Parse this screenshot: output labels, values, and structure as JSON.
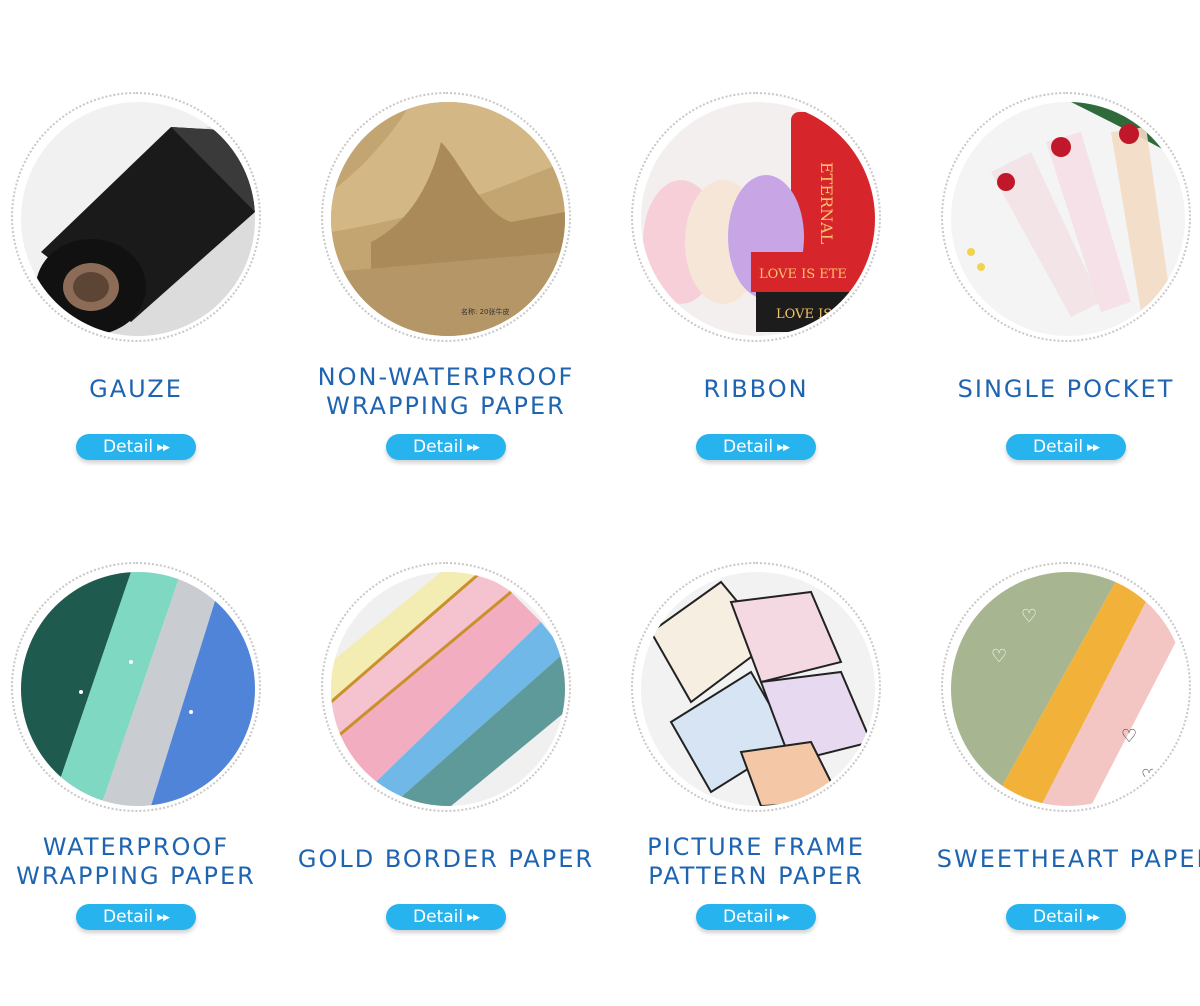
{
  "products": [
    {
      "title": "GAUZE",
      "button": "Detail",
      "image": "black-gauze-roll"
    },
    {
      "title": "NON-WATERPROOF WRAPPING PAPER",
      "button": "Detail",
      "image": "kraft-paper-sheets",
      "label": "名称: 20张牛皮"
    },
    {
      "title": "RIBBON",
      "button": "Detail",
      "image": "ribbon-rolls",
      "ribbon_text": [
        "LOVE IS ETE",
        "LOVE IS",
        "ETERNAL"
      ]
    },
    {
      "title": "SINGLE POCKET",
      "button": "Detail",
      "image": "rose-single-pocket"
    },
    {
      "title": "WATERPROOF WRAPPING PAPER",
      "button": "Detail",
      "image": "waterproof-paper-rolls"
    },
    {
      "title": "GOLD BORDER PAPER",
      "button": "Detail",
      "image": "gold-border-paper-rolls"
    },
    {
      "title": "PICTURE FRAME PATTERN PAPER",
      "button": "Detail",
      "image": "frame-pattern-sheets"
    },
    {
      "title": "SWEETHEART PAPER",
      "button": "Detail",
      "image": "heart-pattern-rolls"
    }
  ],
  "colors": {
    "title": "#1f64b0",
    "button": "#27b4ee"
  },
  "icons": {
    "button_arrow": "double-chevron-right-icon"
  }
}
